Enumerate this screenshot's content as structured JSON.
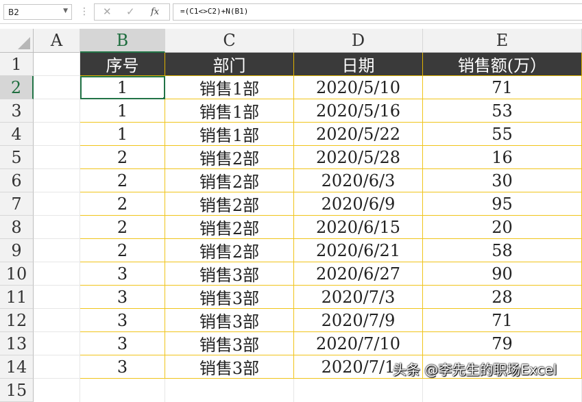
{
  "formula_bar": {
    "name_box": "B2",
    "cancel_icon": "✕",
    "enter_icon": "✓",
    "fx_label": "fx",
    "formula": "=(C1<>C2)+N(B1)"
  },
  "columns": [
    "",
    "A",
    "B",
    "C",
    "D",
    "E"
  ],
  "rows": [
    {
      "num": "1",
      "a": "",
      "b": "序号",
      "c": "部门",
      "d": "日期",
      "e": "销售额(万）"
    },
    {
      "num": "2",
      "a": "",
      "b": "1",
      "c": "销售1部",
      "d": "2020/5/10",
      "e": "71"
    },
    {
      "num": "3",
      "a": "",
      "b": "1",
      "c": "销售1部",
      "d": "2020/5/16",
      "e": "53"
    },
    {
      "num": "4",
      "a": "",
      "b": "1",
      "c": "销售1部",
      "d": "2020/5/22",
      "e": "55"
    },
    {
      "num": "5",
      "a": "",
      "b": "2",
      "c": "销售2部",
      "d": "2020/5/28",
      "e": "16"
    },
    {
      "num": "6",
      "a": "",
      "b": "2",
      "c": "销售2部",
      "d": "2020/6/3",
      "e": "30"
    },
    {
      "num": "7",
      "a": "",
      "b": "2",
      "c": "销售2部",
      "d": "2020/6/9",
      "e": "95"
    },
    {
      "num": "8",
      "a": "",
      "b": "2",
      "c": "销售2部",
      "d": "2020/6/15",
      "e": "20"
    },
    {
      "num": "9",
      "a": "",
      "b": "2",
      "c": "销售2部",
      "d": "2020/6/21",
      "e": "58"
    },
    {
      "num": "10",
      "a": "",
      "b": "3",
      "c": "销售3部",
      "d": "2020/6/27",
      "e": "90"
    },
    {
      "num": "11",
      "a": "",
      "b": "3",
      "c": "销售3部",
      "d": "2020/7/3",
      "e": "28"
    },
    {
      "num": "12",
      "a": "",
      "b": "3",
      "c": "销售3部",
      "d": "2020/7/9",
      "e": "71"
    },
    {
      "num": "13",
      "a": "",
      "b": "3",
      "c": "销售3部",
      "d": "2020/7/10",
      "e": "79"
    },
    {
      "num": "14",
      "a": "",
      "b": "3",
      "c": "销售3部",
      "d": "2020/7/1",
      "e": ""
    },
    {
      "num": "15",
      "a": "",
      "b": "",
      "c": "",
      "d": "",
      "e": ""
    }
  ],
  "watermark": "头条 @李先生的职场Excel",
  "colors": {
    "header_bg": "#3a3a3a",
    "border_accent": "#f0c419",
    "selection": "#217346"
  }
}
